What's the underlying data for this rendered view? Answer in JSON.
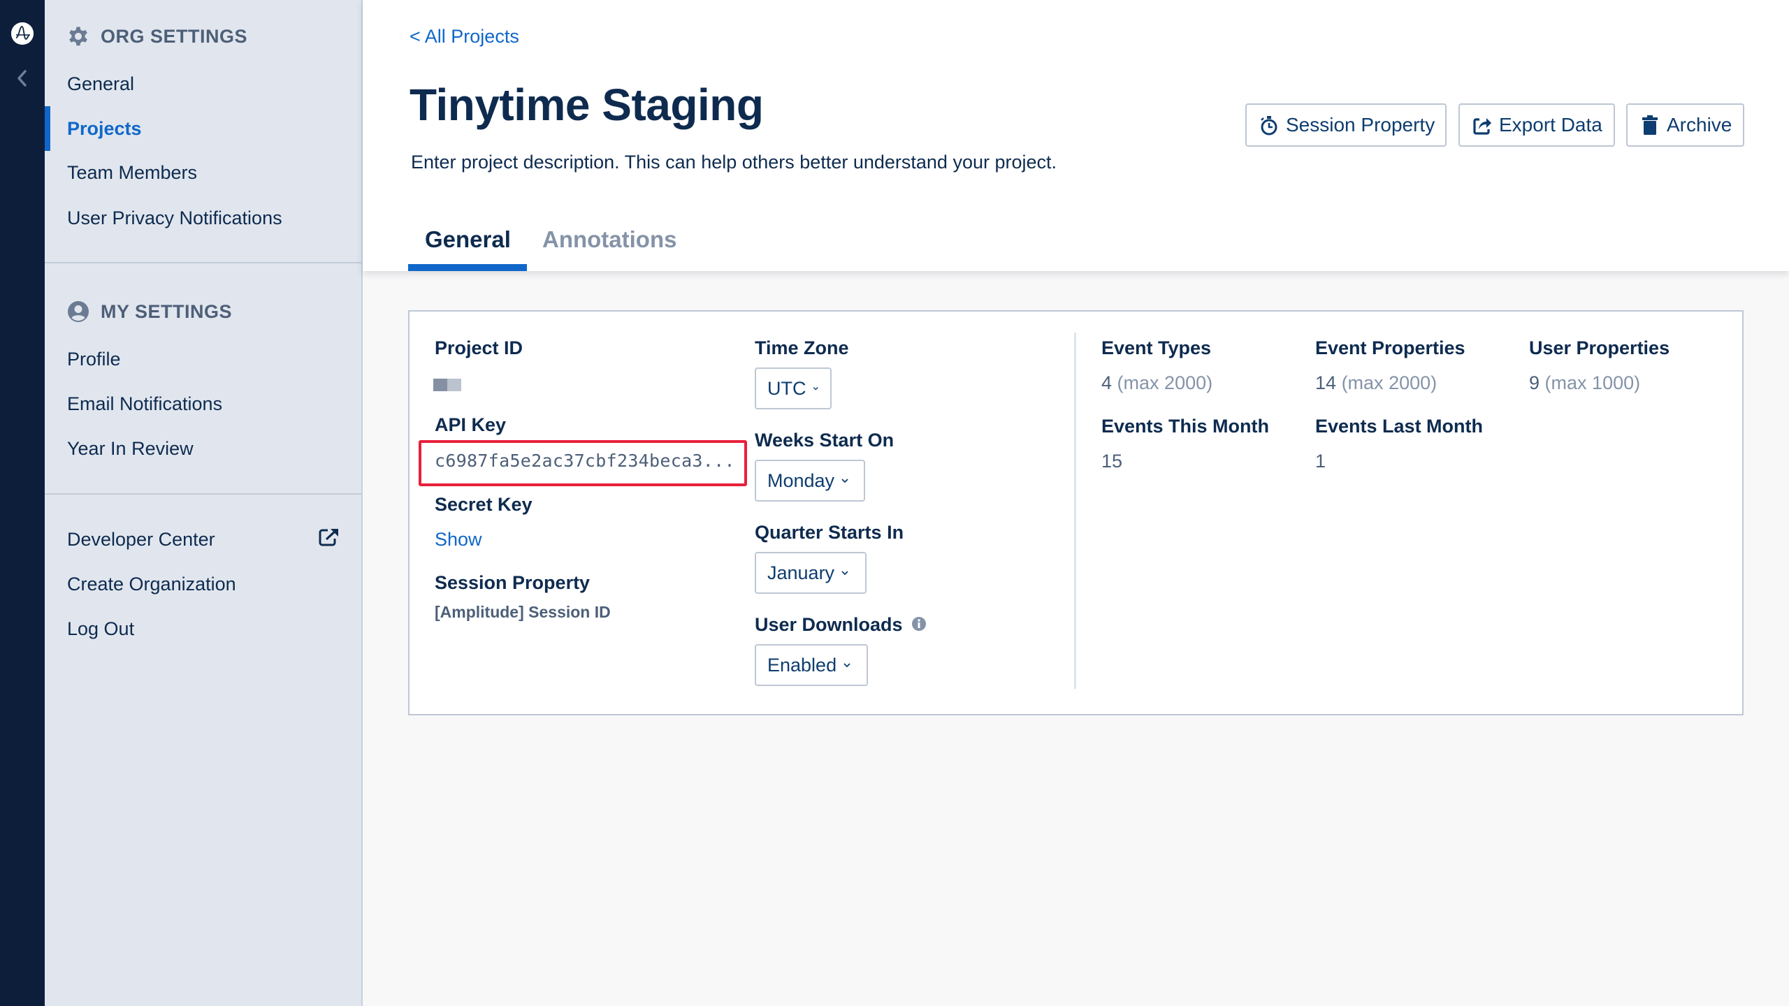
{
  "rail": {
    "logo_icon": "amplitude-logo",
    "collapse_icon": "chevron-left-icon"
  },
  "sidebar": {
    "org_settings": {
      "title": "ORG SETTINGS",
      "icon": "gear-icon",
      "items": [
        {
          "label": "General",
          "active": false
        },
        {
          "label": "Projects",
          "active": true
        },
        {
          "label": "Team Members",
          "active": false
        },
        {
          "label": "User Privacy Notifications",
          "active": false
        }
      ]
    },
    "my_settings": {
      "title": "MY SETTINGS",
      "icon": "user-circle-icon",
      "items": [
        {
          "label": "Profile"
        },
        {
          "label": "Email Notifications"
        },
        {
          "label": "Year In Review"
        }
      ]
    },
    "footer_items": [
      {
        "label": "Developer Center",
        "icon": "external-link-icon"
      },
      {
        "label": "Create Organization"
      },
      {
        "label": "Log Out"
      }
    ]
  },
  "header": {
    "back_link": "< All Projects",
    "title": "Tinytime Staging",
    "description": "Enter project description. This can help others better understand your project.",
    "buttons": [
      {
        "label": "Session Property",
        "icon": "stopwatch-icon"
      },
      {
        "label": "Export Data",
        "icon": "share-export-icon"
      },
      {
        "label": "Archive",
        "icon": "trash-icon"
      }
    ],
    "tabs": [
      {
        "label": "General",
        "active": true
      },
      {
        "label": "Annotations",
        "active": false
      }
    ]
  },
  "details": {
    "project_id_label": "Project ID",
    "api_key_label": "API Key",
    "api_key_value": "c6987fa5e2ac37cbf234beca3...",
    "secret_key_label": "Secret Key",
    "secret_key_action": "Show",
    "session_property_label": "Session Property",
    "session_property_value": "[Amplitude] Session ID"
  },
  "settings": {
    "time_zone": {
      "label": "Time Zone",
      "value": "UTC"
    },
    "weeks_start_on": {
      "label": "Weeks Start On",
      "value": "Monday"
    },
    "quarter_starts_in": {
      "label": "Quarter Starts In",
      "value": "January"
    },
    "user_downloads": {
      "label": "User Downloads",
      "value": "Enabled",
      "info_icon": "info-icon"
    }
  },
  "stats": {
    "event_types": {
      "label": "Event Types",
      "count": "4",
      "limit": "(max 2000)"
    },
    "event_properties": {
      "label": "Event Properties",
      "count": "14",
      "limit": "(max 2000)"
    },
    "user_properties": {
      "label": "User Properties",
      "count": "9",
      "limit": "(max 1000)"
    },
    "events_this_month": {
      "label": "Events This Month",
      "count": "15"
    },
    "events_last_month": {
      "label": "Events Last Month",
      "count": "1"
    }
  },
  "colors": {
    "accent": "#1067c9",
    "rail": "#0d1e3b",
    "sidebar_bg": "#e1e6ee",
    "highlight": "#e8203a",
    "text_primary": "#0e2b4f"
  }
}
